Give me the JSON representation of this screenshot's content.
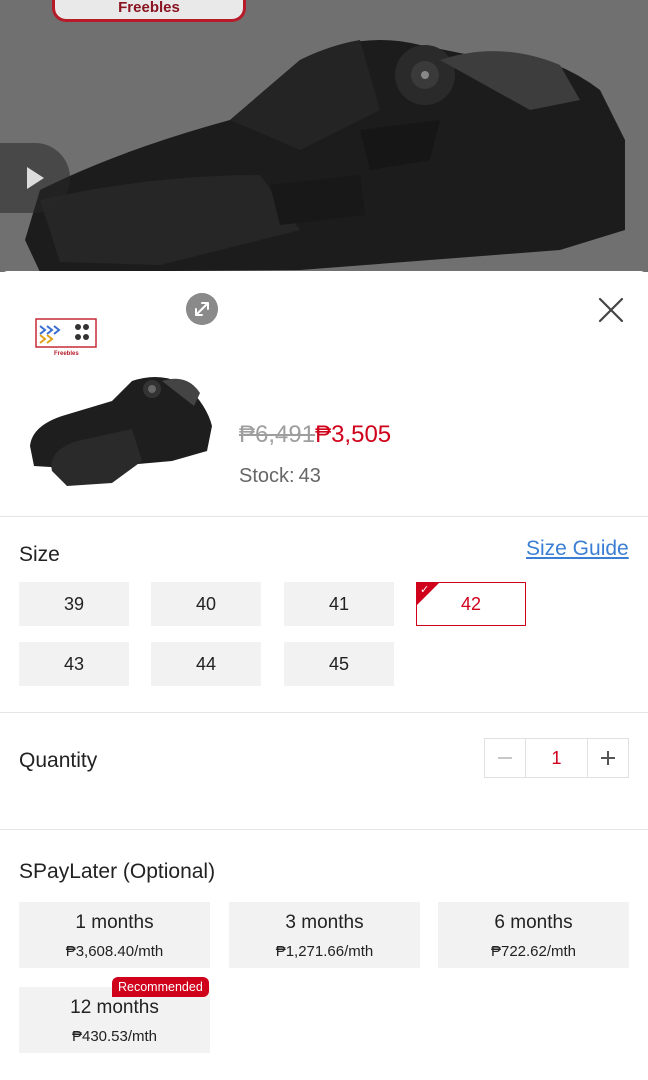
{
  "hero": {
    "banner_text": "Freebles"
  },
  "product": {
    "thumb_banner_text": "Freebles",
    "price_original": "₱6,491",
    "price_current": "₱3,505",
    "stock_label": "Stock:",
    "stock_value": "43"
  },
  "size": {
    "title": "Size",
    "guide_label": "Size Guide",
    "options": [
      "39",
      "40",
      "41",
      "42",
      "43",
      "44",
      "45"
    ],
    "selected": "42"
  },
  "quantity": {
    "title": "Quantity",
    "value": "1",
    "minus_symbol": "−",
    "plus_symbol": "+"
  },
  "spaylater": {
    "title": "SPayLater (Optional)",
    "plans": [
      {
        "term": "1 months",
        "amount": "₱3,608.40/mth"
      },
      {
        "term": "3 months",
        "amount": "₱1,271.66/mth"
      },
      {
        "term": "6 months",
        "amount": "₱722.62/mth"
      },
      {
        "term": "12 months",
        "amount": "₱430.53/mth"
      }
    ],
    "recommended_badge": "Recommended"
  },
  "colors": {
    "accent": "#d0011b",
    "link": "#3b7fd4",
    "option_bg": "#f2f2f2"
  }
}
